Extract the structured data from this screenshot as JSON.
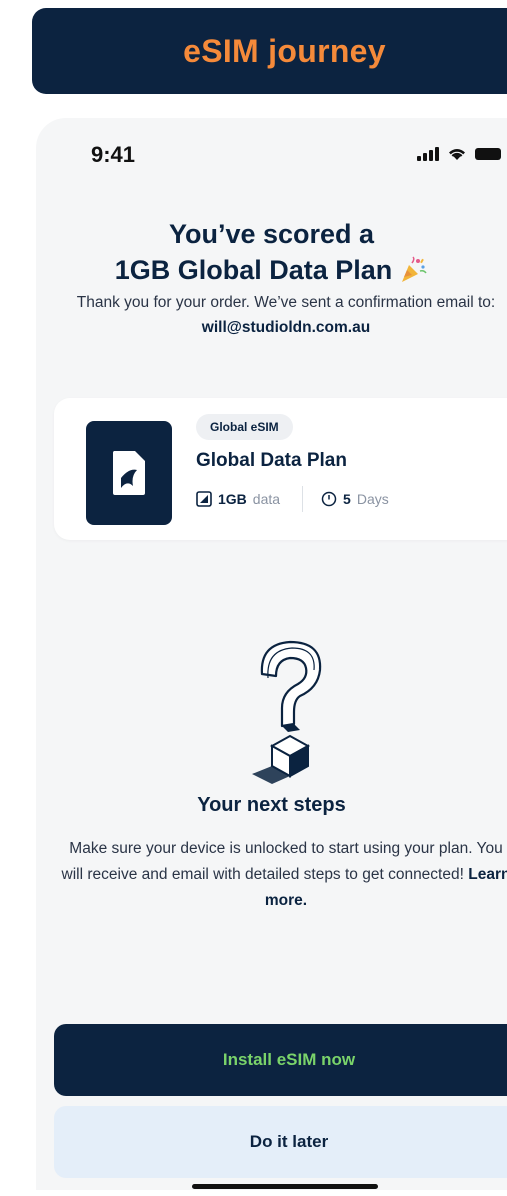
{
  "banner": {
    "title": "eSIM journey"
  },
  "status_bar": {
    "time": "9:41"
  },
  "confirmation": {
    "headline_line1": "You’ve scored a",
    "headline_line2": "1GB Global Data Plan",
    "message_prefix": "Thank you for your order. We’ve sent a confirmation email to:",
    "email": "will@studioldn.com.au"
  },
  "plan_card": {
    "tag": "Global eSIM",
    "name": "Global Data Plan",
    "data_amount": "1GB",
    "data_unit": "data",
    "duration_amount": "5",
    "duration_unit": "Days"
  },
  "next_steps": {
    "title": "Your next steps",
    "body": "Make sure your device is unlocked to start using your plan. You will receive and email with detailed steps to get connected!",
    "link": "Learn more."
  },
  "actions": {
    "primary": "Install eSIM now",
    "secondary": "Do it later"
  },
  "colors": {
    "navy": "#0c2340",
    "orange": "#f58a3a",
    "green": "#7ad36a",
    "light_blue": "#e4eef9"
  }
}
